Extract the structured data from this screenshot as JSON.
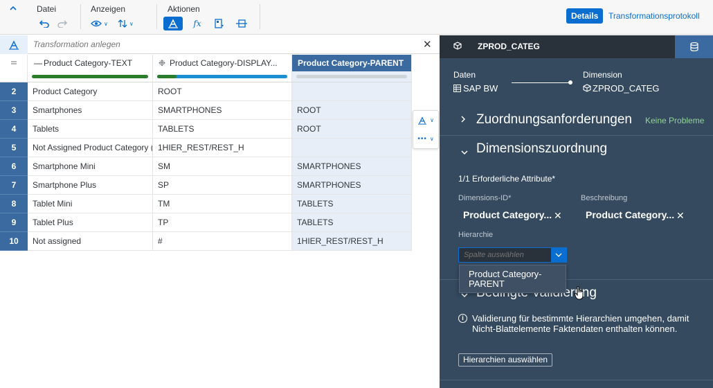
{
  "toolbar": {
    "collapse_icon": "chevron-up-icon",
    "groups": [
      {
        "label": "Datei"
      },
      {
        "label": "Anzeigen"
      },
      {
        "label": "Aktionen"
      }
    ],
    "details_label": "Details",
    "protocol_label": "Transformationsprotokoll"
  },
  "transform": {
    "placeholder": "Transformation anlegen",
    "close": "✕"
  },
  "grid": {
    "columns": [
      {
        "label": "Product Category-TEXT",
        "prefix": "—",
        "quality_fill": 1.0,
        "quality_color": "#2b7d2b"
      },
      {
        "label": "Product Category-DISPLAY...",
        "prefix": "❉",
        "quality_fill": 1.0,
        "quality_color": "#1a8fd4",
        "quality_lead": 0.15,
        "quality_lead_color": "#2b7d2b"
      },
      {
        "label": "Product Category-PARENT",
        "prefix": "",
        "quality_fill": 0,
        "quality_color": "#cfd4d9"
      }
    ],
    "rows": [
      {
        "num": "2",
        "text": "Product Category",
        "display": "ROOT",
        "parent": ""
      },
      {
        "num": "3",
        "text": "Smartphones",
        "display": "SMARTPHONES",
        "parent": "ROOT"
      },
      {
        "num": "4",
        "text": "Tablets",
        "display": "TABLETS",
        "parent": "ROOT"
      },
      {
        "num": "5",
        "text": "Not Assigned Product Category (s",
        "display": "1HIER_REST/REST_H",
        "parent": ""
      },
      {
        "num": "6",
        "text": "Smartphone Mini",
        "display": "SM",
        "parent": "SMARTPHONES"
      },
      {
        "num": "7",
        "text": "Smartphone Plus",
        "display": "SP",
        "parent": "SMARTPHONES"
      },
      {
        "num": "8",
        "text": "Tablet Mini",
        "display": "TM",
        "parent": "TABLETS"
      },
      {
        "num": "9",
        "text": "Tablet Plus",
        "display": "TP",
        "parent": "TABLETS"
      },
      {
        "num": "10",
        "text": "Not assigned",
        "display": "#",
        "parent": "1HIER_REST/REST_H"
      }
    ]
  },
  "panel": {
    "title": "ZPROD_CATEG",
    "source_label": "Daten",
    "source_value": "SAP BW",
    "target_label": "Dimension",
    "target_value": "ZPROD_CATEG",
    "section1": "Zuordnungsanforderungen",
    "section1_status": "Keine Probleme",
    "section2": "Dimensionszuordnung",
    "required": "1/1  Erforderliche Attribute*",
    "dimid_label": "Dimensions-ID*",
    "dimid_value": "Product Category...",
    "desc_label": "Beschreibung",
    "desc_value": "Product Category...",
    "hier_label": "Hierarchie",
    "hier_placeholder": "Spalte auswählen",
    "dropdown_option": "Product Category-PARENT",
    "section3": "Bedingte Validierung",
    "info_text": "Validierung für bestimmte Hierarchien umgehen, damit Nicht-Blattelemente Faktendaten enthalten können.",
    "button_label": "Hierarchien auswählen"
  },
  "colors": {
    "accent": "#0a6ed1",
    "panel_bg": "#354a5f",
    "panel_header": "#29313a",
    "rownum_bg": "#3b6aa0",
    "ok_text": "#8fd694"
  }
}
